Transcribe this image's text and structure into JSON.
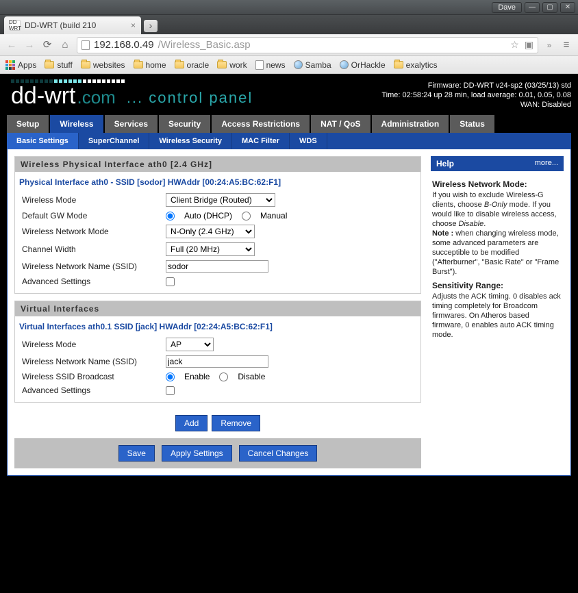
{
  "window": {
    "user": "Dave"
  },
  "browser": {
    "tab_title": "DD-WRT (build 210",
    "url_host": "192.168.0.49",
    "url_path": "/Wireless_Basic.asp",
    "bookmarks": [
      "Apps",
      "stuff",
      "websites",
      "home",
      "oracle",
      "work",
      "news",
      "Samba",
      "OrHackle",
      "exalytics"
    ]
  },
  "header": {
    "firmware": "Firmware: DD-WRT v24-sp2 (03/25/13) std",
    "time": "Time: 02:58:24 up 28 min, load average: 0.01, 0.05, 0.08",
    "wan": "WAN: Disabled",
    "logo_com": ".com",
    "tagline": "... control panel"
  },
  "tabs": {
    "main": [
      "Setup",
      "Wireless",
      "Services",
      "Security",
      "Access Restrictions",
      "NAT / QoS",
      "Administration",
      "Status"
    ],
    "main_active": 1,
    "sub": [
      "Basic Settings",
      "SuperChannel",
      "Wireless Security",
      "MAC Filter",
      "WDS"
    ],
    "sub_active": 0
  },
  "phys": {
    "legend": "Wireless Physical Interface ath0 [2.4 GHz]",
    "subhdr": "Physical Interface ath0 - SSID [sodor] HWAddr [00:24:A5:BC:62:F1]",
    "labels": {
      "mode": "Wireless Mode",
      "gw": "Default GW Mode",
      "net": "Wireless Network Mode",
      "cw": "Channel Width",
      "ssid": "Wireless Network Name (SSID)",
      "adv": "Advanced Settings"
    },
    "values": {
      "mode": "Client Bridge (Routed)",
      "gw_auto": "Auto (DHCP)",
      "gw_manual": "Manual",
      "net": "N-Only (2.4 GHz)",
      "cw": "Full (20 MHz)",
      "ssid": "sodor"
    }
  },
  "virt": {
    "legend": "Virtual Interfaces",
    "subhdr": "Virtual Interfaces ath0.1 SSID [jack] HWAddr [02:24:A5:BC:62:F1]",
    "labels": {
      "mode": "Wireless Mode",
      "ssid": "Wireless Network Name (SSID)",
      "bcast": "Wireless SSID Broadcast",
      "adv": "Advanced Settings"
    },
    "values": {
      "mode": "AP",
      "ssid": "jack",
      "enable": "Enable",
      "disable": "Disable"
    }
  },
  "buttons": {
    "add": "Add",
    "remove": "Remove",
    "save": "Save",
    "apply": "Apply Settings",
    "cancel": "Cancel Changes"
  },
  "help": {
    "title": "Help",
    "more": "more...",
    "h1": "Wireless Network Mode:",
    "p1a": "If you wish to exclude Wireless-G clients, choose ",
    "p1b": "B-Only",
    "p1c": " mode. If you would like to disable wireless access, choose ",
    "p1d": "Disable",
    "p1e": ".",
    "p1note": "Note : when changing wireless mode, some advanced parameters are succeptible to be modified (\"Afterburner\", \"Basic Rate\" or \"Frame Burst\").",
    "h2": "Sensitivity Range:",
    "p2": "Adjusts the ACK timing. 0 disables ack timing completely for Broadcom firmwares. On Atheros based firmware, 0 enables auto ACK timing mode."
  }
}
